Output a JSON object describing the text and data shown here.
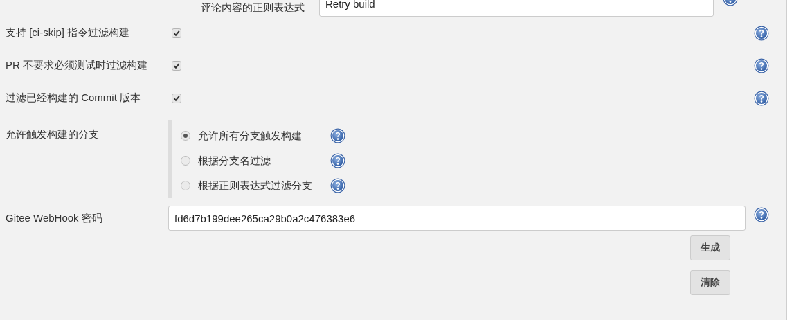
{
  "comment_regex": {
    "label": "评论内容的正则表达式",
    "value": "Retry build"
  },
  "options": [
    {
      "label": "支持 [ci-skip] 指令过滤构建",
      "checked": true
    },
    {
      "label": "PR 不要求必须测试时过滤构建",
      "checked": true
    },
    {
      "label": "过滤已经构建的 Commit 版本",
      "checked": true
    }
  ],
  "branch_filter": {
    "label": "允许触发构建的分支",
    "choices": [
      {
        "label": "允许所有分支触发构建",
        "selected": true
      },
      {
        "label": "根据分支名过滤",
        "selected": false
      },
      {
        "label": "根据正则表达式过滤分支",
        "selected": false
      }
    ]
  },
  "webhook_secret": {
    "label": "Gitee WebHook 密码",
    "value": "fd6d7b199dee265ca29b0a2c476383e6"
  },
  "buttons": [
    "生成",
    "清除"
  ]
}
